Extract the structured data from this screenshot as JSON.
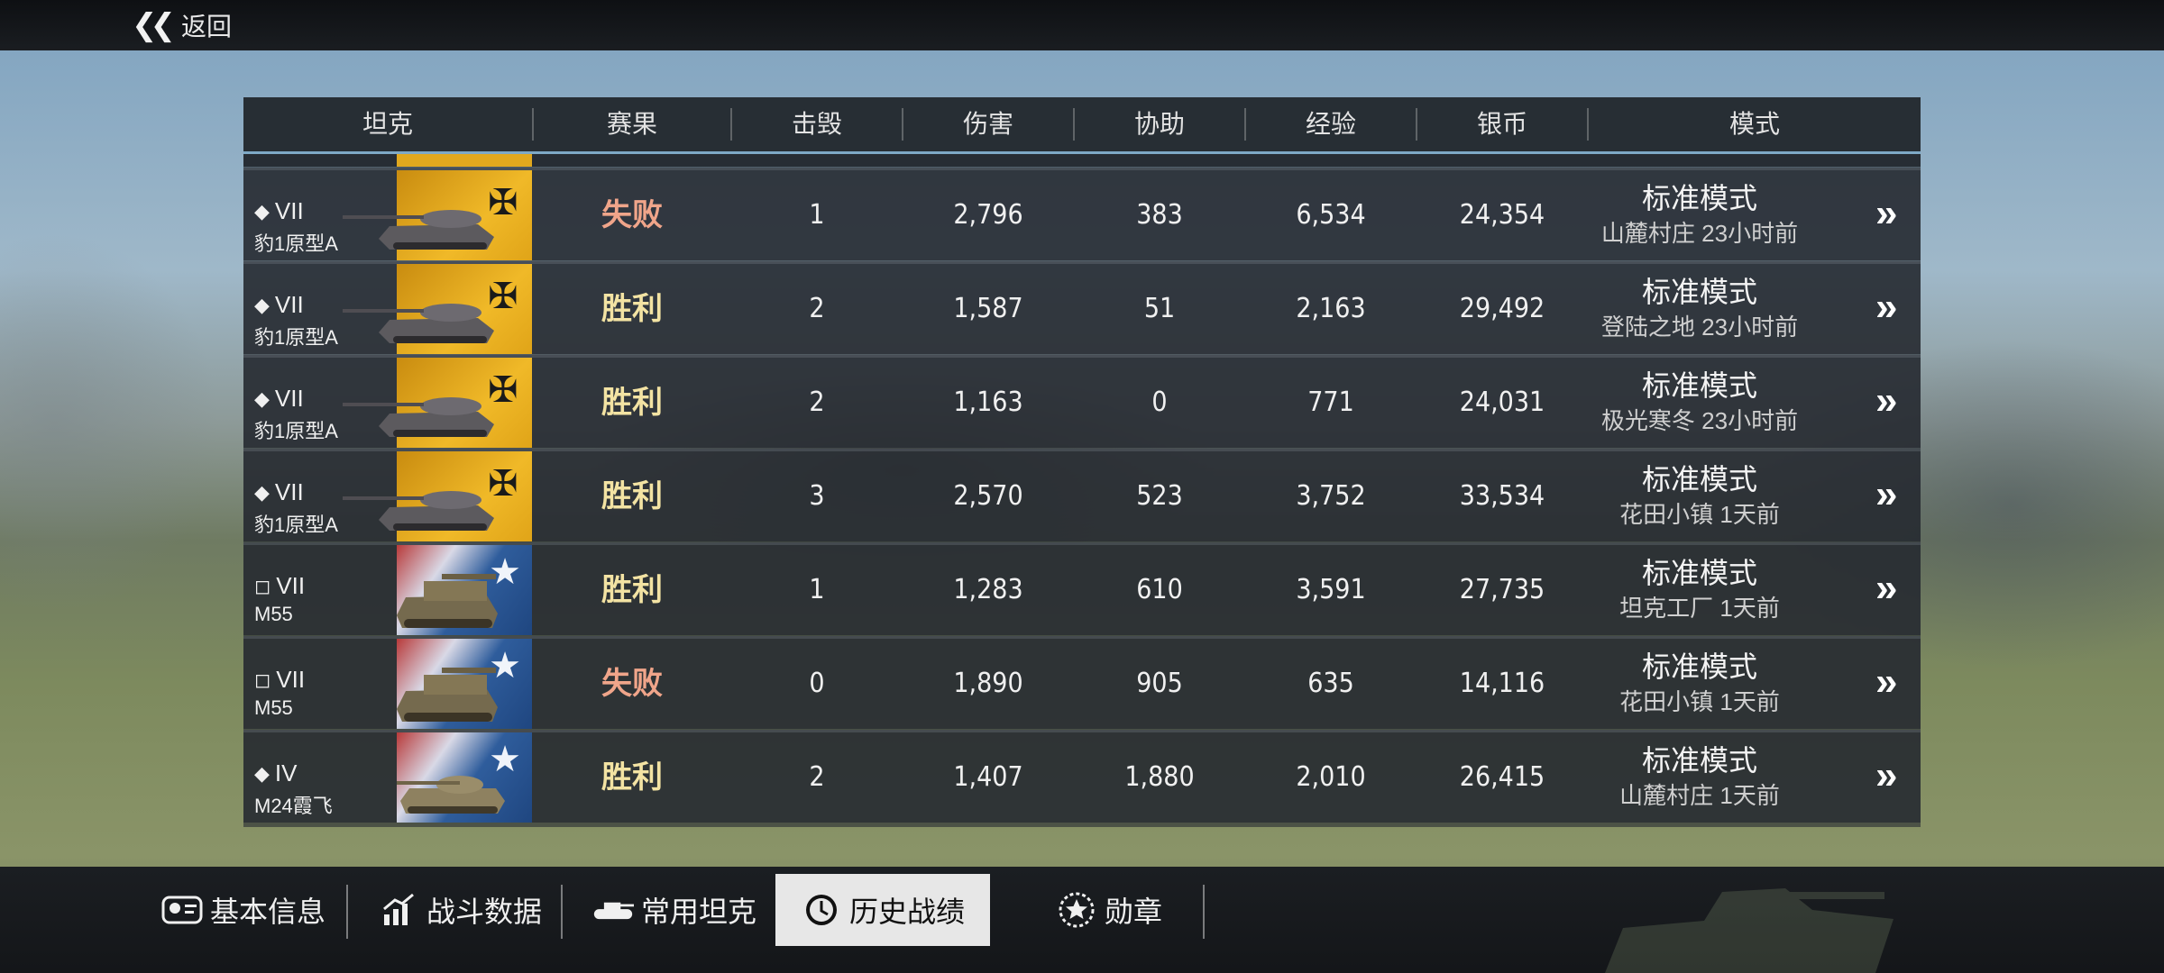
{
  "top": {
    "back_label": "返回"
  },
  "table": {
    "headers": [
      "坦克",
      "赛果",
      "击毁",
      "伤害",
      "协助",
      "经验",
      "银币",
      "模式"
    ],
    "rows": [
      {
        "tier": "VII",
        "class_icon": "medium-tank-icon",
        "tank_name": "豹1原型A",
        "nation": "germany",
        "result": "失败",
        "result_color": "#f0a58a",
        "kills": "1",
        "damage": "2,796",
        "assist": "383",
        "exp": "6,534",
        "silver": "24,354",
        "mode": "标准模式",
        "map_time": "山麓村庄 23小时前"
      },
      {
        "tier": "VII",
        "class_icon": "medium-tank-icon",
        "tank_name": "豹1原型A",
        "nation": "germany",
        "result": "胜利",
        "result_color": "#f3e3a3",
        "kills": "2",
        "damage": "1,587",
        "assist": "51",
        "exp": "2,163",
        "silver": "29,492",
        "mode": "标准模式",
        "map_time": "登陆之地 23小时前"
      },
      {
        "tier": "VII",
        "class_icon": "medium-tank-icon",
        "tank_name": "豹1原型A",
        "nation": "germany",
        "result": "胜利",
        "result_color": "#f3e3a3",
        "kills": "2",
        "damage": "1,163",
        "assist": "0",
        "exp": "771",
        "silver": "24,031",
        "mode": "标准模式",
        "map_time": "极光寒冬 23小时前"
      },
      {
        "tier": "VII",
        "class_icon": "medium-tank-icon",
        "tank_name": "豹1原型A",
        "nation": "germany",
        "result": "胜利",
        "result_color": "#f3e3a3",
        "kills": "3",
        "damage": "2,570",
        "assist": "523",
        "exp": "3,752",
        "silver": "33,534",
        "mode": "标准模式",
        "map_time": "花田小镇 1天前"
      },
      {
        "tier": "VII",
        "class_icon": "spg-icon",
        "tank_name": "M55",
        "nation": "usa",
        "result": "胜利",
        "result_color": "#f3e3a3",
        "kills": "1",
        "damage": "1,283",
        "assist": "610",
        "exp": "3,591",
        "silver": "27,735",
        "mode": "标准模式",
        "map_time": "坦克工厂 1天前"
      },
      {
        "tier": "VII",
        "class_icon": "spg-icon",
        "tank_name": "M55",
        "nation": "usa",
        "result": "失败",
        "result_color": "#f0a58a",
        "kills": "0",
        "damage": "1,890",
        "assist": "905",
        "exp": "635",
        "silver": "14,116",
        "mode": "标准模式",
        "map_time": "花田小镇 1天前"
      },
      {
        "tier": "IV",
        "class_icon": "light-tank-icon",
        "tank_name": "M24霞飞",
        "nation": "usa",
        "result": "胜利",
        "result_color": "#f3e3a3",
        "kills": "2",
        "damage": "1,407",
        "assist": "1,880",
        "exp": "2,010",
        "silver": "26,415",
        "mode": "标准模式",
        "map_time": "山麓村庄 1天前"
      }
    ]
  },
  "tabs": [
    {
      "label": "基本信息",
      "icon": "profile-card-icon",
      "active": false
    },
    {
      "label": "战斗数据",
      "icon": "bar-chart-icon",
      "active": false
    },
    {
      "label": "常用坦克",
      "icon": "tank-icon",
      "active": false
    },
    {
      "label": "历史战绩",
      "icon": "clock-icon",
      "active": true
    },
    {
      "label": "勋章",
      "icon": "medal-icon",
      "active": false
    }
  ],
  "colors": {
    "header_accent": "#7ea9c6",
    "active_tab_bg": "#e7e7e7"
  }
}
